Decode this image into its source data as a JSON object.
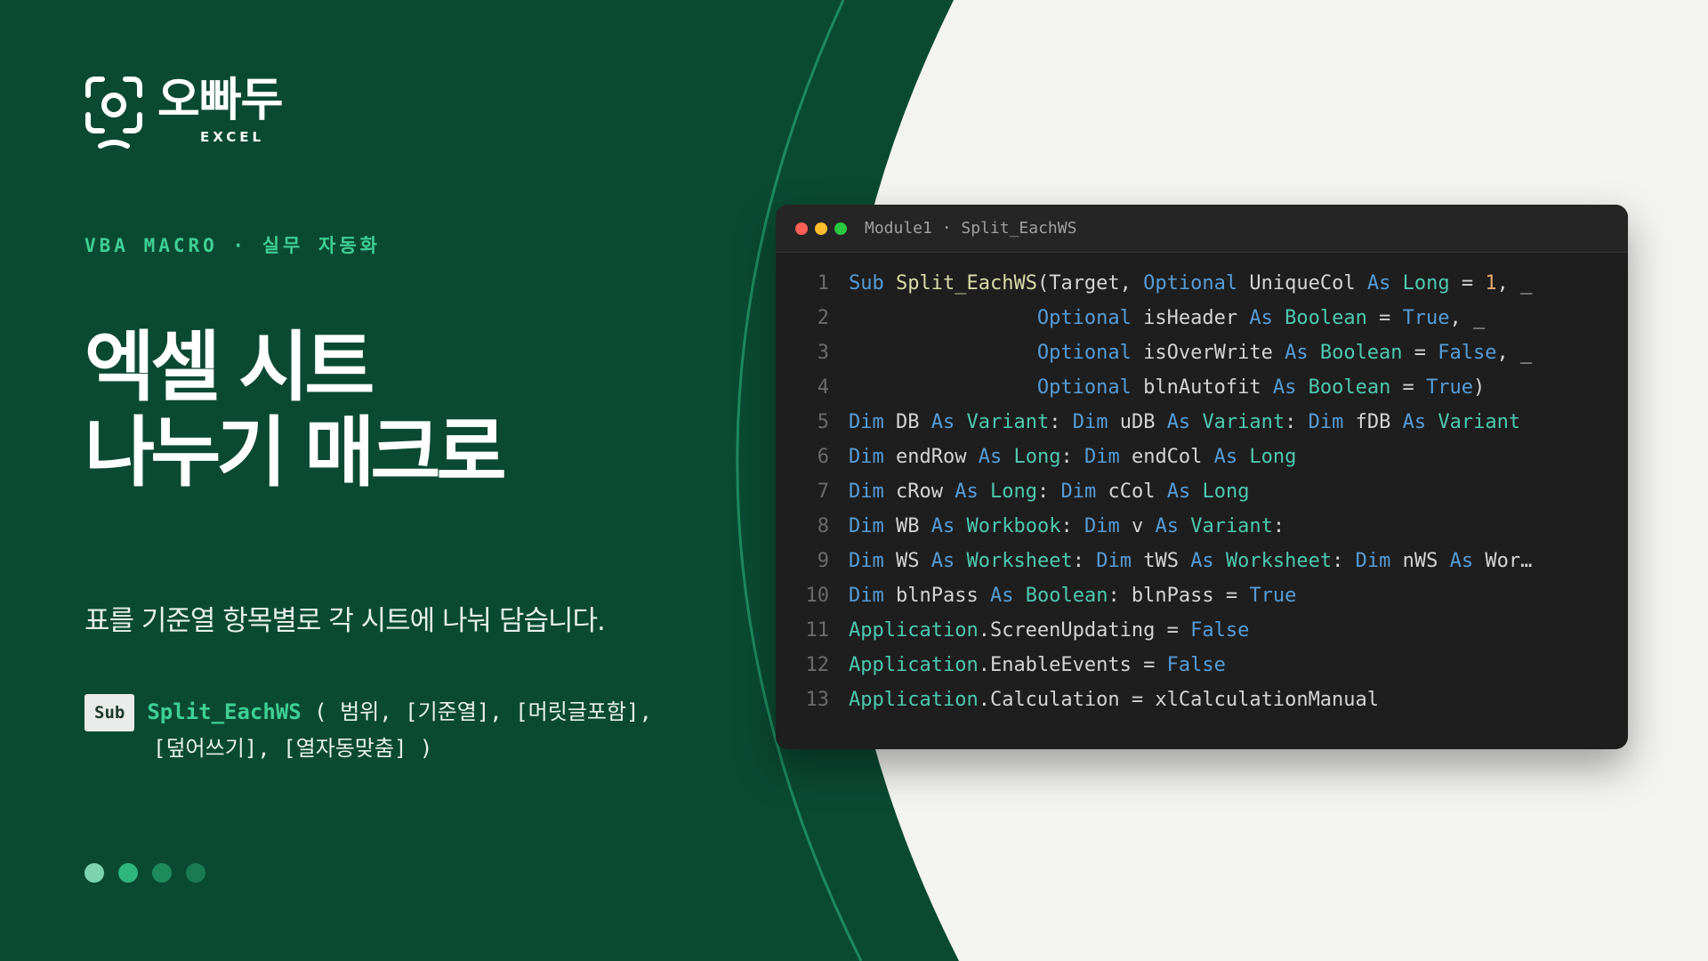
{
  "brand": {
    "name": "오빠두",
    "sub": "EXCEL",
    "icon": "camera-frame-logo-icon"
  },
  "tagline": "VBA MACRO · 실무 자동화",
  "title": {
    "line1": "엑셀 시트",
    "line2": "나누기 매크로"
  },
  "description": "표를 기준열 항목별로 각 시트에 나눠 담습니다.",
  "signature": {
    "badge": "Sub",
    "function_name": "Split_EachWS",
    "params_line1": " ( 범위, [기준열], [머릿글포함],",
    "params_line2": "[덮어쓰기], [열자동맞춤] )"
  },
  "pagination": {
    "count": 4,
    "colors": [
      "#7dd3b0",
      "#2fb57e",
      "#1f8a5c",
      "#1a7a52"
    ]
  },
  "editor": {
    "title": "Module1 · Split_EachWS",
    "lines": [
      {
        "n": "1",
        "tokens": [
          [
            "kw",
            "Sub"
          ],
          [
            "pl",
            " "
          ],
          [
            "nm",
            "Split_EachWS"
          ],
          [
            "pl",
            "(Target, "
          ],
          [
            "kw",
            "Optional"
          ],
          [
            "pl",
            " UniqueCol "
          ],
          [
            "kw",
            "As"
          ],
          [
            "pl",
            " "
          ],
          [
            "ty",
            "Long"
          ],
          [
            "pl",
            " = "
          ],
          [
            "nu",
            "1"
          ],
          [
            "pl",
            ", _"
          ]
        ]
      },
      {
        "n": "2",
        "tokens": [
          [
            "pl",
            "                "
          ],
          [
            "kw",
            "Optional"
          ],
          [
            "pl",
            " isHeader "
          ],
          [
            "kw",
            "As"
          ],
          [
            "pl",
            " "
          ],
          [
            "ty",
            "Boolean"
          ],
          [
            "pl",
            " = "
          ],
          [
            "kw",
            "True"
          ],
          [
            "pl",
            ", _"
          ]
        ]
      },
      {
        "n": "3",
        "tokens": [
          [
            "pl",
            "                "
          ],
          [
            "kw",
            "Optional"
          ],
          [
            "pl",
            " isOverWrite "
          ],
          [
            "kw",
            "As"
          ],
          [
            "pl",
            " "
          ],
          [
            "ty",
            "Boolean"
          ],
          [
            "pl",
            " = "
          ],
          [
            "kw",
            "False"
          ],
          [
            "pl",
            ", _"
          ]
        ]
      },
      {
        "n": "4",
        "tokens": [
          [
            "pl",
            "                "
          ],
          [
            "kw",
            "Optional"
          ],
          [
            "pl",
            " blnAutofit "
          ],
          [
            "kw",
            "As"
          ],
          [
            "pl",
            " "
          ],
          [
            "ty",
            "Boolean"
          ],
          [
            "pl",
            " = "
          ],
          [
            "kw",
            "True"
          ],
          [
            "pl",
            ")"
          ]
        ]
      },
      {
        "n": "5",
        "tokens": [
          [
            "kw",
            "Dim"
          ],
          [
            "pl",
            " DB "
          ],
          [
            "kw",
            "As"
          ],
          [
            "pl",
            " "
          ],
          [
            "ty",
            "Variant"
          ],
          [
            "pl",
            ": "
          ],
          [
            "kw",
            "Dim"
          ],
          [
            "pl",
            " uDB "
          ],
          [
            "kw",
            "As"
          ],
          [
            "pl",
            " "
          ],
          [
            "ty",
            "Variant"
          ],
          [
            "pl",
            ": "
          ],
          [
            "kw",
            "Dim"
          ],
          [
            "pl",
            " fDB "
          ],
          [
            "kw",
            "As"
          ],
          [
            "pl",
            " "
          ],
          [
            "ty",
            "Variant"
          ]
        ]
      },
      {
        "n": "6",
        "tokens": [
          [
            "kw",
            "Dim"
          ],
          [
            "pl",
            " endRow "
          ],
          [
            "kw",
            "As"
          ],
          [
            "pl",
            " "
          ],
          [
            "ty",
            "Long"
          ],
          [
            "pl",
            ": "
          ],
          [
            "kw",
            "Dim"
          ],
          [
            "pl",
            " endCol "
          ],
          [
            "kw",
            "As"
          ],
          [
            "pl",
            " "
          ],
          [
            "ty",
            "Long"
          ]
        ]
      },
      {
        "n": "7",
        "tokens": [
          [
            "kw",
            "Dim"
          ],
          [
            "pl",
            " cRow "
          ],
          [
            "kw",
            "As"
          ],
          [
            "pl",
            " "
          ],
          [
            "ty",
            "Long"
          ],
          [
            "pl",
            ": "
          ],
          [
            "kw",
            "Dim"
          ],
          [
            "pl",
            " cCol "
          ],
          [
            "kw",
            "As"
          ],
          [
            "pl",
            " "
          ],
          [
            "ty",
            "Long"
          ]
        ]
      },
      {
        "n": "8",
        "tokens": [
          [
            "kw",
            "Dim"
          ],
          [
            "pl",
            " WB "
          ],
          [
            "kw",
            "As"
          ],
          [
            "pl",
            " "
          ],
          [
            "ty",
            "Workbook"
          ],
          [
            "pl",
            ": "
          ],
          [
            "kw",
            "Dim"
          ],
          [
            "pl",
            " v "
          ],
          [
            "kw",
            "As"
          ],
          [
            "pl",
            " "
          ],
          [
            "ty",
            "Variant"
          ],
          [
            "pl",
            ":"
          ]
        ]
      },
      {
        "n": "9",
        "tokens": [
          [
            "kw",
            "Dim"
          ],
          [
            "pl",
            " WS "
          ],
          [
            "kw",
            "As"
          ],
          [
            "pl",
            " "
          ],
          [
            "ty",
            "Worksheet"
          ],
          [
            "pl",
            ": "
          ],
          [
            "kw",
            "Dim"
          ],
          [
            "pl",
            " tWS "
          ],
          [
            "kw",
            "As"
          ],
          [
            "pl",
            " "
          ],
          [
            "ty",
            "Worksheet"
          ],
          [
            "pl",
            ": "
          ],
          [
            "kw",
            "Dim"
          ],
          [
            "pl",
            " nWS "
          ],
          [
            "kw",
            "As"
          ],
          [
            "pl",
            " Wor…"
          ]
        ]
      },
      {
        "n": "10",
        "tokens": [
          [
            "kw",
            "Dim"
          ],
          [
            "pl",
            " blnPass "
          ],
          [
            "kw",
            "As"
          ],
          [
            "pl",
            " "
          ],
          [
            "ty",
            "Boolean"
          ],
          [
            "pl",
            ": blnPass = "
          ],
          [
            "kw",
            "True"
          ]
        ]
      },
      {
        "n": "11",
        "tokens": [
          [
            "ty",
            "Application"
          ],
          [
            "pl",
            ".ScreenUpdating = "
          ],
          [
            "kw",
            "False"
          ]
        ]
      },
      {
        "n": "12",
        "tokens": [
          [
            "ty",
            "Application"
          ],
          [
            "pl",
            ".EnableEvents = "
          ],
          [
            "kw",
            "False"
          ]
        ]
      },
      {
        "n": "13",
        "tokens": [
          [
            "ty",
            "Application"
          ],
          [
            "pl",
            ".Calculation = xlCalculationManual"
          ]
        ]
      }
    ]
  },
  "colors": {
    "brand_green": "#0a4a33",
    "accent": "#3fcf94",
    "light_bg": "#f3f3f1",
    "editor_bg": "#1e1e1e"
  }
}
